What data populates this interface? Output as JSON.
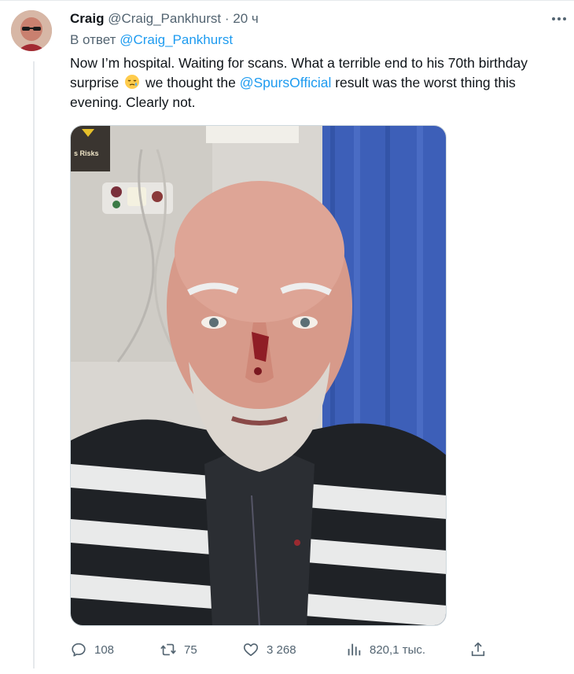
{
  "tweet": {
    "author": {
      "display_name": "Craig",
      "handle": "@Craig_Pankhurst",
      "separator": "·",
      "time": "20 ч"
    },
    "reply_prefix": "В ответ",
    "reply_to": "@Craig_Pankhurst",
    "text_part1": "Now I’m hospital. Waiting for scans. What a terrible end to his 70th birthday surprise",
    "emoji": "sleepy-face-emoji",
    "text_part2": "we thought the",
    "mention": "@SpursOfficial",
    "text_part3": "result was the worst thing this evening. Clearly not.",
    "media": {
      "type": "photo",
      "sign_text": "s Risks"
    },
    "actions": {
      "replies": "108",
      "retweets": "75",
      "likes": "3 268",
      "views": "820,1 тыс."
    }
  },
  "colors": {
    "text": "#0f1419",
    "secondary": "#536471",
    "link": "#1d9bf0",
    "border": "#cfd9de"
  }
}
